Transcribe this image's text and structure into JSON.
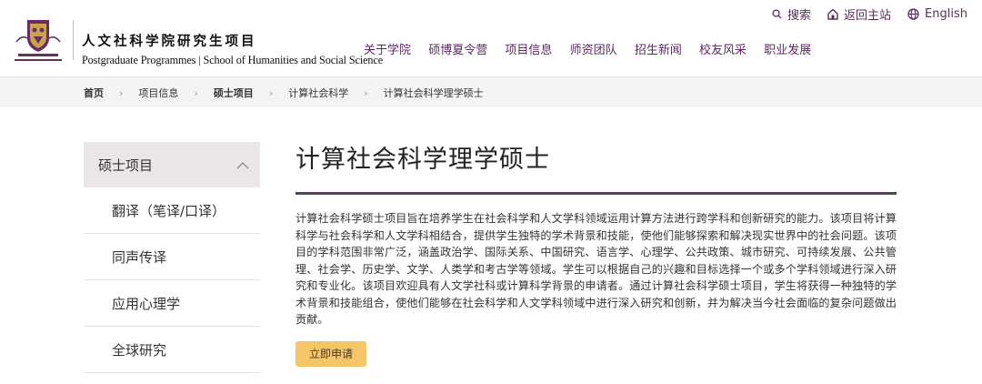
{
  "header": {
    "title_cn": "人文社科学院研究生项目",
    "title_en": "Postgraduate Programmes | School of Humanities and Social Science",
    "top_links": [
      {
        "label": "搜索",
        "icon": "search-icon"
      },
      {
        "label": "返回主站",
        "icon": "home-icon"
      },
      {
        "label": "English",
        "icon": "globe-icon"
      }
    ],
    "nav": [
      "关于学院",
      "硕博夏令营",
      "项目信息",
      "师资团队",
      "招生新闻",
      "校友风采",
      "职业发展"
    ]
  },
  "breadcrumb": [
    "首页",
    "项目信息",
    "硕士项目",
    "计算社会科学",
    "计算社会科学理学硕士"
  ],
  "sidebar": {
    "head": "硕士项目",
    "items": [
      "翻译（笔译/口译）",
      "同声传译",
      "应用心理学",
      "全球研究"
    ]
  },
  "main": {
    "title": "计算社会科学理学硕士",
    "description": "计算社会科学硕士项目旨在培养学生在社会科学和人文学科领域运用计算方法进行跨学科和创新研究的能力。该项目将计算科学与社会科学和人文学科相结合，提供学生独特的学术背景和技能，使他们能够探索和解决现实世界中的社会问题。该项目的学科范围非常广泛，涵盖政治学、国际关系、中国研究、语言学、心理学、公共政策、城市研究、可持续发展、公共管理、社会学、历史学、文学、人类学和考古学等领域。学生可以根据自己的兴趣和目标选择一个或多个学科领域进行深入研究和专业化。该项目欢迎具有人文学社科或计算科学背景的申请者。通过计算社会科学硕士项目，学生将获得一种独特的学术背景和技能组合，使他们能够在社会科学和人文学科领域中进行深入研究和创新，并为解决当今社会面临的复杂问题做出贡献。",
    "apply_label": "立即申请"
  },
  "colors": {
    "brand_purple": "#5b2a5f",
    "rule": "#5d3b67",
    "button": "#f5c667",
    "sidebar_head": "#ebe6e5"
  }
}
